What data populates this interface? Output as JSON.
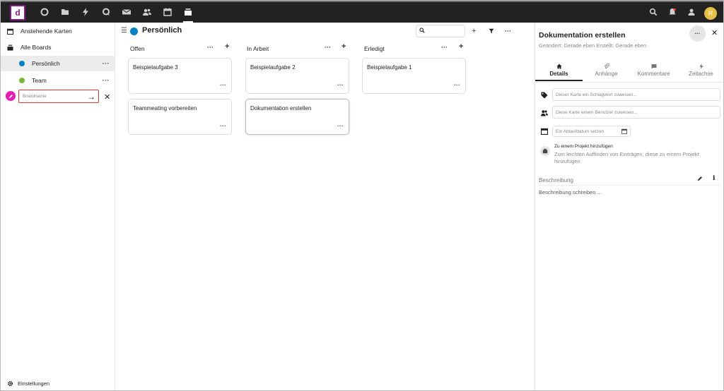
{
  "app": {
    "logo_text": "d",
    "avatar_initial": "R",
    "nav_icons": [
      "dashboard-icon",
      "files-icon",
      "activity-icon",
      "talk-icon",
      "mail-icon",
      "contacts-icon",
      "calendar-icon",
      "deck-icon"
    ],
    "accent": "#0082c9"
  },
  "sidebar": {
    "upcoming": "Anstehende Karten",
    "all_boards": "Alle Boards",
    "boards": [
      {
        "label": "Persönlich",
        "color": "#0082c9"
      },
      {
        "label": "Team",
        "color": "#7ab833"
      }
    ],
    "new_board_placeholder": "Boardname",
    "new_board_color": "#e71db3",
    "settings": "Einstellungen"
  },
  "board": {
    "title": "Persönlich",
    "stacks": [
      {
        "title": "Offen",
        "cards": [
          "Beispielaufgabe 3",
          "Teammeating vorbereiten"
        ]
      },
      {
        "title": "In Arbeit",
        "cards": [
          "Beispielaufgabe 2",
          "Dokumentation erstellen"
        ]
      },
      {
        "title": "Erledigt",
        "cards": [
          "Beispielaufgabe 1"
        ]
      }
    ]
  },
  "detail": {
    "title": "Dokumentation erstellen",
    "subtitle": "Geändert: Gerade eben Erstellt: Gerade eben",
    "tabs": [
      "Details",
      "Anhänge",
      "Kommentare",
      "Zeitachse"
    ],
    "tag_placeholder": "Dieser Karte ein Schlagwort zuweisen...",
    "user_placeholder": "Diese Karte einem Benutzer zuweisen...",
    "due_placeholder": "Ein Ablaufdatum setzen",
    "project_title": "Zu einem Projekt hinzufügen",
    "project_desc": "Zum leichten Auffinden von Einträgen, diese zu einem Projekt hinzufügen",
    "description_label": "Beschreibung",
    "description_placeholder": "Beschreibung schreiben ..."
  }
}
